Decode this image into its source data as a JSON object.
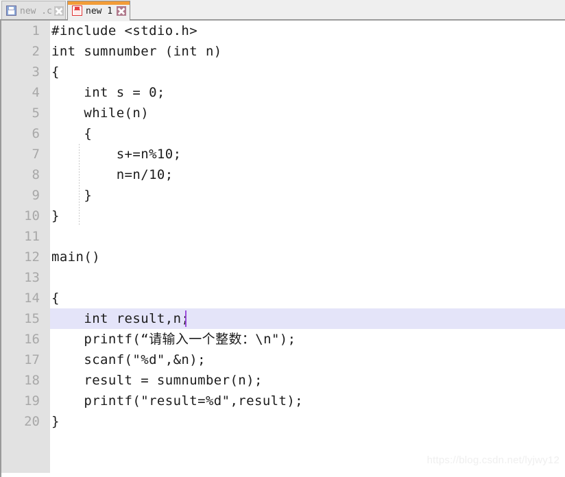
{
  "tabs": [
    {
      "label": "new .c",
      "icon": "floppy-disk-icon",
      "close_icon": "close-icon",
      "active": false
    },
    {
      "label": "new 1",
      "icon": "floppy-disk-icon",
      "close_icon": "close-icon",
      "active": true
    }
  ],
  "editor": {
    "highlight_line": 15,
    "caret_line": 15,
    "lines": [
      {
        "n": "1",
        "text": "#include <stdio.h>"
      },
      {
        "n": "2",
        "text": "int sumnumber (int n)"
      },
      {
        "n": "3",
        "text": "{"
      },
      {
        "n": "4",
        "text": "    int s = 0;"
      },
      {
        "n": "5",
        "text": "    while(n)"
      },
      {
        "n": "6",
        "text": "    {"
      },
      {
        "n": "7",
        "text": "        s+=n%10;"
      },
      {
        "n": "8",
        "text": "        n=n/10;"
      },
      {
        "n": "9",
        "text": "    }"
      },
      {
        "n": "10",
        "text": "}"
      },
      {
        "n": "11",
        "text": ""
      },
      {
        "n": "12",
        "text": "main()"
      },
      {
        "n": "13",
        "text": ""
      },
      {
        "n": "14",
        "text": "{"
      },
      {
        "n": "15",
        "text": "    int result,n;"
      },
      {
        "n": "16",
        "text": "    printf(“请输入一个整数：\\n\");"
      },
      {
        "n": "17",
        "text": "    scanf(\"%d\",&n);"
      },
      {
        "n": "18",
        "text": "    result = sumnumber(n);"
      },
      {
        "n": "19",
        "text": "    printf(\"result=%d\",result);"
      },
      {
        "n": "20",
        "text": "}"
      }
    ]
  },
  "watermark": {
    "text": "https://blog.csdn.net/lyjwy12"
  },
  "colors": {
    "tabbar_bg": "#efefef",
    "gutter_bg": "#e2e2e2",
    "line_number": "#a8a8a8",
    "code_text": "#1b1b1b",
    "active_tab_accent": "#f29c38",
    "highlight_line_bg": "#e4e4f9",
    "caret": "#9b4ddb",
    "watermark": "#efefef"
  }
}
